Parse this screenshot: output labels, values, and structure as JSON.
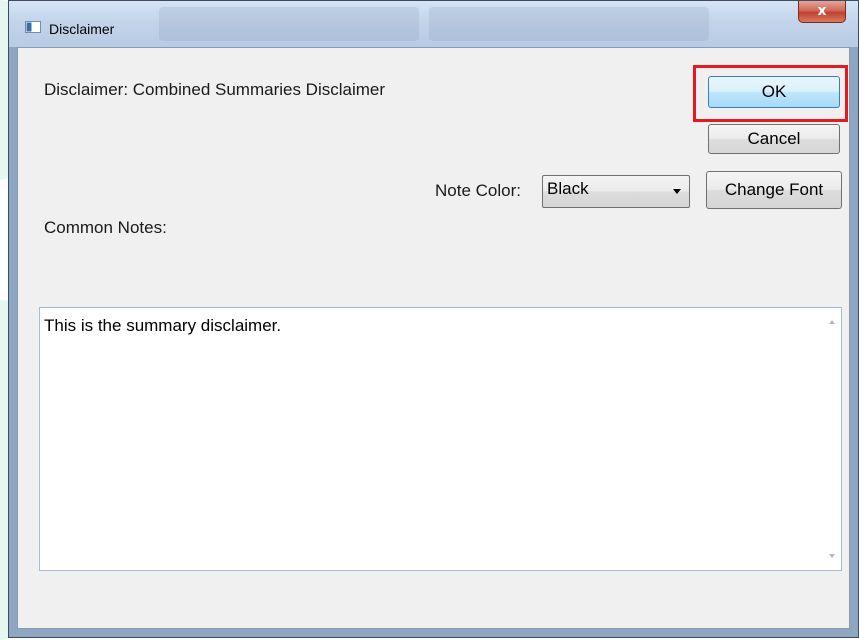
{
  "window": {
    "title": "Disclaimer",
    "close_glyph": "x"
  },
  "dialog": {
    "disclaimer_label": "Disclaimer: Combined Summaries Disclaimer",
    "ok_label": "OK",
    "cancel_label": "Cancel",
    "note_color_label": "Note Color:",
    "note_color_value": "Black",
    "change_font_label": "Change Font",
    "common_notes_label": "Common Notes:",
    "notes_text": "This is the summary disclaimer."
  },
  "colors": {
    "highlight": "#e8191d",
    "ok_accent": "#3c7fb1"
  },
  "icons": {
    "window_icon": "window-icon",
    "dropdown": "chevron-down-icon",
    "scroll_up": "scroll-up-arrow-icon",
    "scroll_down": "scroll-down-arrow-icon"
  }
}
